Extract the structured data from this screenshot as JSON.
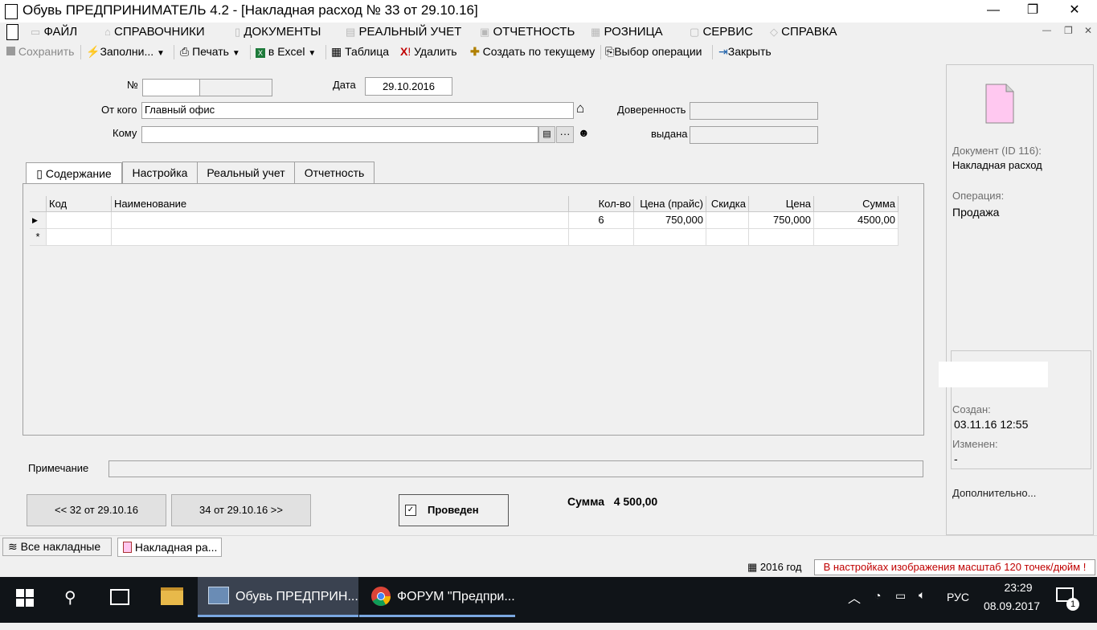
{
  "window": {
    "title": "Обувь  ПРЕДПРИНИМАТЕЛЬ 4.2 - [Накладная расход № 33 от 29.10.16]",
    "minimize_glyph": "—",
    "maximize_glyph": "❐",
    "close_glyph": "✕"
  },
  "menu": {
    "items": [
      "ФАЙЛ",
      "СПРАВОЧНИКИ",
      "ДОКУМЕНТЫ",
      "РЕАЛЬНЫЙ УЧЕТ",
      "ОТЧЕТНОСТЬ",
      "РОЗНИЦА",
      "СЕРВИС",
      "СПРАВКА"
    ]
  },
  "toolbar": {
    "save": "Сохранить",
    "fill": "Заполни...",
    "print": "Печать",
    "excel": "в Excel",
    "table": "Таблица",
    "delete": "Удалить",
    "create_from": "Создать по текущему",
    "choose_op": "Выбор операции",
    "close": "Закрыть"
  },
  "form": {
    "number_label": "№",
    "number_value": "",
    "date_label": "Дата",
    "date_value": "29.10.2016",
    "from_label": "От кого",
    "from_value": "Главный офис",
    "to_label": "Кому",
    "to_value": "",
    "proxy_label": "Доверенность",
    "issued_label": "выдана"
  },
  "tabs": [
    "Содержание",
    "Настройка",
    "Реальный учет",
    "Отчетность"
  ],
  "grid": {
    "headers": [
      "Код",
      "Наименование",
      "Кол-во",
      "Цена (прайс)",
      "Скидка",
      "Цена",
      "Сумма"
    ],
    "rows": [
      {
        "code": "",
        "name": "",
        "qty": "6",
        "price_list": "750,000",
        "discount": "",
        "price": "750,000",
        "sum": "4500,00"
      }
    ],
    "new_row_marker": "*"
  },
  "note": {
    "label": "Примечание",
    "value": ""
  },
  "nav": {
    "prev": "<< 32 от 29.10.16",
    "next": "34 от 29.10.16 >>"
  },
  "posted": {
    "label": "Проведен",
    "checked": true
  },
  "total": {
    "label": "Сумма",
    "value": "4 500,00"
  },
  "side": {
    "doc_label": "Документ  (ID 116):",
    "doc_value": "Накладная расход",
    "op_label": "Операция:",
    "op_value": "Продажа",
    "created_label": "Создан:",
    "created_value": "03.11.16  12:55",
    "changed_label": "Изменен:",
    "changed_value": "-",
    "more": "Дополнительно..."
  },
  "bottom_tabs": [
    "Все накладные",
    "Накладная ра..."
  ],
  "status": {
    "year": "2016 год",
    "warning": "В настройках изображения масштаб 120 точек/дюйм !"
  },
  "taskbar": {
    "app1": "Обувь  ПРЕДПРИН...",
    "app2": "ФОРУМ \"Предпри...",
    "lang": "РУС",
    "time": "23:29",
    "date": "08.09.2017",
    "notif_count": "1"
  },
  "colors": {
    "warning_text": "#c00000",
    "doc_icon": "#ffc8f0",
    "taskbar": "#101418"
  }
}
